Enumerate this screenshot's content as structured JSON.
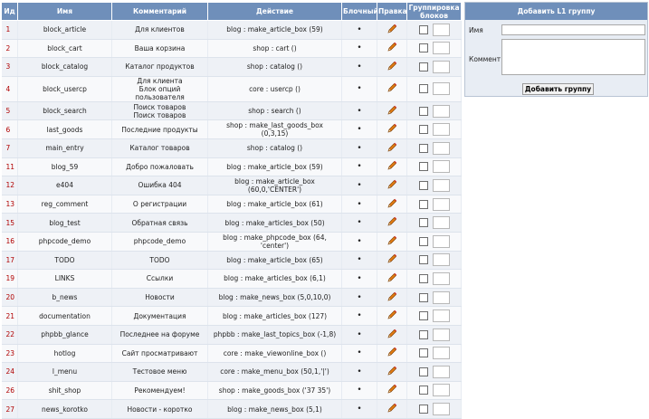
{
  "table": {
    "headers": {
      "id": "Ид",
      "name": "Имя",
      "comment": "Комментарий",
      "action": "Действие",
      "block": "Блочный",
      "edit": "Правка",
      "group": "Группировка блоков"
    },
    "rows": [
      {
        "id": "1",
        "name": "block_article",
        "comment": "Для клиентов",
        "action": "blog : make_article_box (59)",
        "block": "•"
      },
      {
        "id": "2",
        "name": "block_cart",
        "comment": "Ваша корзина",
        "action": "shop : cart ()",
        "block": "•"
      },
      {
        "id": "3",
        "name": "block_catalog",
        "comment": "Каталог продуктов",
        "action": "shop : catalog ()",
        "block": "•"
      },
      {
        "id": "4",
        "name": "block_usercp",
        "comment": "Для клиента\nБлок опций пользователя",
        "action": "core : usercp ()",
        "block": "•"
      },
      {
        "id": "5",
        "name": "block_search",
        "comment": "Поиск товаров\nПоиск товаров",
        "action": "shop : search ()",
        "block": "•"
      },
      {
        "id": "6",
        "name": "last_goods",
        "comment": "Последние продукты",
        "action": "shop : make_last_goods_box\n(0,3,15)",
        "block": "•"
      },
      {
        "id": "7",
        "name": "main_entry",
        "comment": "Каталог товаров",
        "action": "shop : catalog ()",
        "block": "•"
      },
      {
        "id": "11",
        "name": "blog_59",
        "comment": "Добро пожаловать",
        "action": "blog : make_article_box (59)",
        "block": "•"
      },
      {
        "id": "12",
        "name": "e404",
        "comment": "Ошибка 404",
        "action": "blog : make_article_box\n(60,0,'CENTER')",
        "block": "•"
      },
      {
        "id": "13",
        "name": "reg_comment",
        "comment": "О регистрации",
        "action": "blog : make_article_box (61)",
        "block": "•"
      },
      {
        "id": "15",
        "name": "blog_test",
        "comment": "Обратная связь",
        "action": "blog : make_articles_box (50)",
        "block": "•"
      },
      {
        "id": "16",
        "name": "phpcode_demo",
        "comment": "phpcode_demo",
        "action": "blog : make_phpcode_box (64,\n'center')",
        "block": "•"
      },
      {
        "id": "17",
        "name": "TODO",
        "comment": "TODO",
        "action": "blog : make_article_box (65)",
        "block": "•"
      },
      {
        "id": "19",
        "name": "LINKS",
        "comment": "Ссылки",
        "action": "blog : make_articles_box (6,1)",
        "block": "•"
      },
      {
        "id": "20",
        "name": "b_news",
        "comment": "Новости",
        "action": "blog : make_news_box (5,0,10,0)",
        "block": "•"
      },
      {
        "id": "21",
        "name": "documentation",
        "comment": "Документация",
        "action": "blog : make_articles_box (127)",
        "block": "•"
      },
      {
        "id": "22",
        "name": "phpbb_glance",
        "comment": "Последнее на форуме",
        "action": "phpbb : make_last_topics_box (-1,8)",
        "block": "•"
      },
      {
        "id": "23",
        "name": "hotlog",
        "comment": "Сайт просматривают",
        "action": "core : make_viewonline_box ()",
        "block": "•"
      },
      {
        "id": "24",
        "name": "l_menu",
        "comment": "Тестовое меню",
        "action": "core : make_menu_box (50,1,'|')",
        "block": "•"
      },
      {
        "id": "26",
        "name": "shit_shop",
        "comment": "Рекомендуем!",
        "action": "shop : make_goods_box ('37 35')",
        "block": "•"
      },
      {
        "id": "27",
        "name": "news_korotko",
        "comment": "Новости - коротко",
        "action": "blog : make_news_box (5,1)",
        "block": "•"
      }
    ]
  },
  "add_form": {
    "title": "Добавить L1 группу",
    "name_label": "Имя",
    "comment_label": "Коммент",
    "name_value": "",
    "comment_value": "",
    "submit_label": "Добавить группу"
  },
  "colors": {
    "header_bg": "#6f8fba",
    "id_text": "#b00000"
  },
  "icons": {
    "edit": "pencil-icon"
  }
}
